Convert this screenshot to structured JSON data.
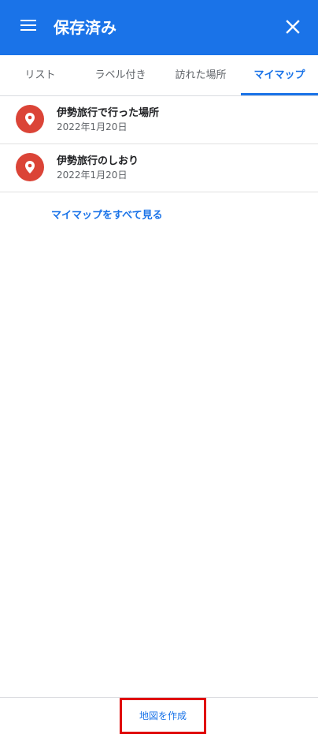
{
  "header": {
    "title": "保存済み",
    "menu_icon": "menu-icon",
    "close_icon": "close-icon",
    "background": "#1a73e8"
  },
  "tabs": [
    {
      "label": "リスト",
      "active": false
    },
    {
      "label": "ラベル付き",
      "active": false
    },
    {
      "label": "訪れた場所",
      "active": false
    },
    {
      "label": "マイマップ",
      "active": true
    }
  ],
  "maps": [
    {
      "title": "伊勢旅行で行った場所",
      "date": "2022年1月20日",
      "icon": "map-pin-icon"
    },
    {
      "title": "伊勢旅行のしおり",
      "date": "2022年1月20日",
      "icon": "map-pin-icon"
    }
  ],
  "see_all_label": "マイマップをすべて見る",
  "footer": {
    "create_label": "地図を作成"
  },
  "colors": {
    "accent": "#1a73e8",
    "pin": "#db4437",
    "highlight_box": "#e00000"
  }
}
